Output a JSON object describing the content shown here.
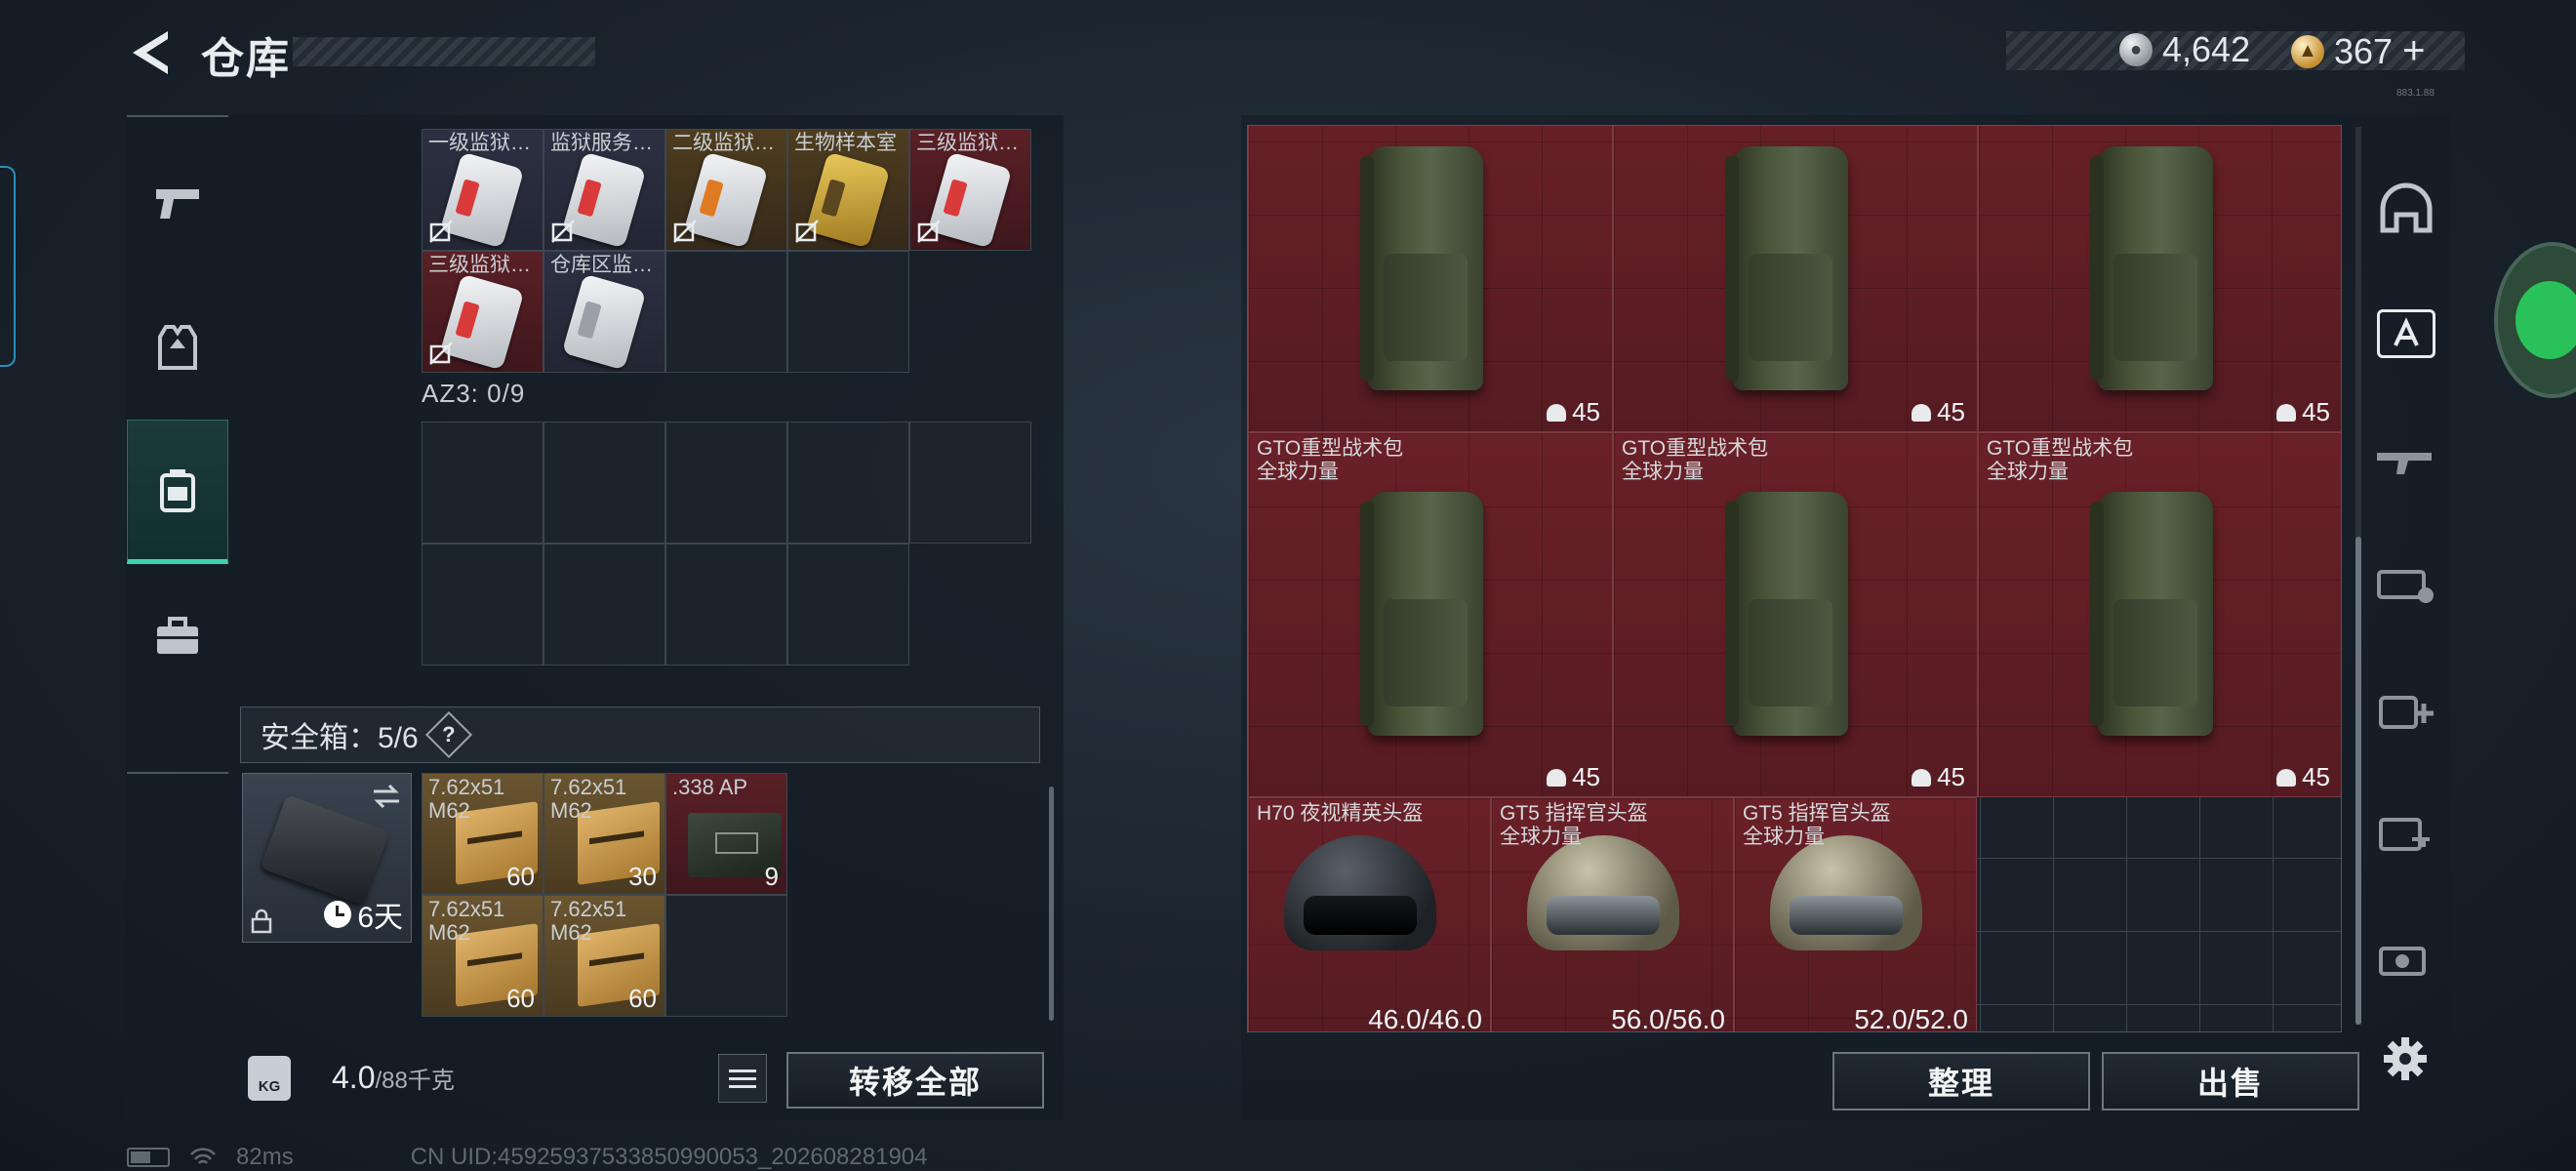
{
  "header": {
    "title": "仓库",
    "currency": [
      {
        "icon": "silver-coin-icon",
        "value": "4,642"
      },
      {
        "icon": "gold-coin-icon",
        "value": "367"
      }
    ],
    "plus": "+"
  },
  "left_rail": [
    {
      "name": "weapon-category",
      "icon": "pistol-icon"
    },
    {
      "name": "armor-category",
      "icon": "vest-icon"
    },
    {
      "name": "backpack-category",
      "icon": "backpack-icon",
      "active": true
    },
    {
      "name": "supplies-category",
      "icon": "toolbox-icon"
    }
  ],
  "keycards": [
    {
      "label": "一级监狱…",
      "rarity": "purple",
      "stripe": "#d93a3a"
    },
    {
      "label": "监狱服务…",
      "rarity": "purple",
      "stripe": "#d93a3a"
    },
    {
      "label": "二级监狱…",
      "rarity": "gold",
      "stripe": "#e07a22"
    },
    {
      "label": "生物样本室",
      "rarity": "gold",
      "stripe": "#5a4720",
      "gold": true
    },
    {
      "label": "三级监狱…",
      "rarity": "red",
      "stripe": "#d93a3a"
    },
    {
      "label": "三级监狱…",
      "rarity": "red",
      "stripe": "#d93a3a"
    },
    {
      "label": "仓库区监…",
      "rarity": "purple",
      "stripe": "#9aa0a6"
    }
  ],
  "az3": {
    "label": "AZ3: 0/9"
  },
  "safe_box": {
    "label": "安全箱：5/6",
    "help": "?",
    "duration": "6天",
    "items": [
      {
        "name": "7.62x51 M62",
        "count": "60",
        "kind": "ammo"
      },
      {
        "name": "7.62x51 M62",
        "count": "30",
        "kind": "ammo"
      },
      {
        "name": ".338 AP",
        "count": "9",
        "kind": "mil"
      },
      {
        "name": "7.62x51 M62",
        "count": "60",
        "kind": "ammo"
      },
      {
        "name": "7.62x51 M62",
        "count": "60",
        "kind": "ammo"
      }
    ]
  },
  "footer": {
    "kg_icon": "KG",
    "weight": "4.0",
    "capacity": "/88千克",
    "transfer_all": "转移全部",
    "sort": "整理",
    "sell": "出售"
  },
  "status": {
    "ping": "82ms",
    "uid": "CN UID:45925937533850990053_202608281904"
  },
  "version": "883.1.88",
  "stash": {
    "backpacks_top": [
      {
        "count": "45"
      },
      {
        "count": "45"
      },
      {
        "count": "45"
      }
    ],
    "backpacks_mid": [
      {
        "name": "GTO重型战术包",
        "brand": "全球力量",
        "count": "45"
      },
      {
        "name": "GTO重型战术包",
        "brand": "全球力量",
        "count": "45"
      },
      {
        "name": "GTO重型战术包",
        "brand": "全球力量",
        "count": "45"
      }
    ],
    "helmets": [
      {
        "name": "H70 夜视精英头盔",
        "brand": "",
        "durability": "46.0/46.0",
        "color": "#3b3f44"
      },
      {
        "name": "GT5 指挥官头盔",
        "brand": "全球力量",
        "durability": "56.0/56.0",
        "color": "#9a9580"
      },
      {
        "name": "GT5 指挥官头盔",
        "brand": "全球力量",
        "durability": "52.0/52.0",
        "color": "#9a9580"
      }
    ]
  },
  "tools": [
    {
      "name": "helmet-filter-icon"
    },
    {
      "name": "gti-a-filter-icon",
      "active": true
    },
    {
      "name": "gti-weapon-filter-icon"
    },
    {
      "name": "gti-ammo-filter-icon"
    },
    {
      "name": "iv-medkit-filter-icon"
    },
    {
      "name": "gti-key-filter-icon"
    },
    {
      "name": "v-misc-filter-icon"
    }
  ]
}
